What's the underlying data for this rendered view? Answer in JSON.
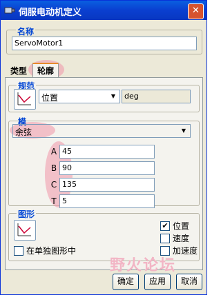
{
  "window": {
    "title": "伺服电动机定义",
    "close_label": "✕"
  },
  "name_group": {
    "label": "名称",
    "value": "ServoMotor1"
  },
  "tabs": [
    {
      "label": "类型"
    },
    {
      "label": "轮廓"
    }
  ],
  "spec_group": {
    "label": "规范",
    "combo_value": "位置",
    "unit": "deg"
  },
  "model_group": {
    "label": "模",
    "combo_value": "余弦"
  },
  "params": [
    {
      "label": "A",
      "value": "45"
    },
    {
      "label": "B",
      "value": "90"
    },
    {
      "label": "C",
      "value": "135"
    },
    {
      "label": "T",
      "value": "5"
    }
  ],
  "graph_group": {
    "label": "图形",
    "separate_label": "在单独图形中",
    "checks": [
      {
        "label": "位置",
        "checked": true
      },
      {
        "label": "速度",
        "checked": false
      },
      {
        "label": "加速度",
        "checked": false
      }
    ]
  },
  "buttons": {
    "ok": "确定",
    "apply": "应用",
    "cancel": "取消"
  },
  "watermark": "野火论坛",
  "icons": [
    "servo-motor-icon",
    "close-icon",
    "spec-graph-icon",
    "dropdown-arrow-icon",
    "graph-icon",
    "checkmark-icon"
  ],
  "highlight_color": "#f096aa"
}
